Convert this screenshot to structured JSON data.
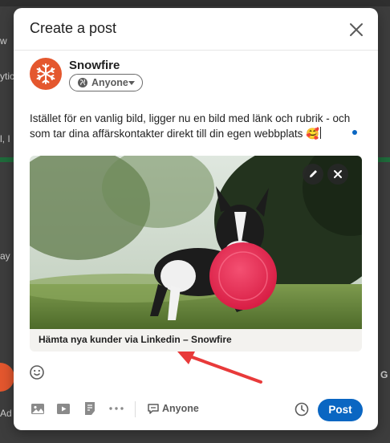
{
  "background": {
    "text_left_1": "w",
    "text_left_2": "ytic",
    "text_left_3": "l, I",
    "text_left_4": "ay",
    "text_left_5": "Ad",
    "text_right_1": "G"
  },
  "modal": {
    "title": "Create a post",
    "author_name": "Snowfire",
    "audience_label": "Anyone",
    "post_text": "Istället för en vanlig bild, ligger nu en bild med länk och rubrik -  och som tar dina affärskontakter direkt till din egen webbplats 🥰",
    "link_card": {
      "caption": "Hämta nya kunder via Linkedin – Snowfire"
    },
    "footer": {
      "comment_audience_label": "Anyone",
      "post_button_label": "Post"
    }
  },
  "colors": {
    "brand_orange": "#e4572e",
    "linkedin_blue": "#0a66c2",
    "annotation_arrow": "#e83a3a"
  },
  "icons": {
    "close": "close-icon",
    "globe": "globe-icon",
    "edit": "pencil-icon",
    "remove": "close-icon",
    "emoji": "smiley-icon",
    "photo": "image-icon",
    "video": "video-icon",
    "document": "document-icon",
    "more": "more-icon",
    "comment": "comment-icon",
    "schedule": "clock-icon"
  }
}
